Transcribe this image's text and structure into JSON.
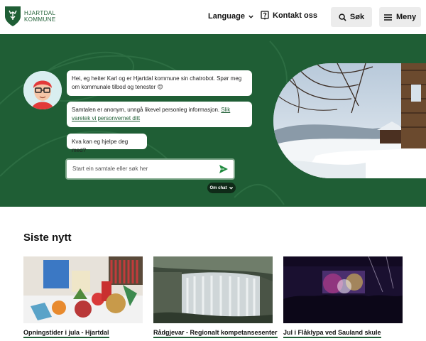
{
  "header": {
    "logo_line1": "Hjartdal",
    "logo_line2": "Kommune",
    "language_label": "Language",
    "contact_label": "Kontakt oss",
    "search_label": "Søk",
    "menu_label": "Meny",
    "icons": {
      "logo": "hjartdal-crest-icon",
      "language": "chevron-down-icon",
      "contact": "question-box-icon",
      "search": "search-icon",
      "menu": "hamburger-icon"
    }
  },
  "chatbot": {
    "messages": [
      {
        "text": "Hei, eg heiter Karl og er Hjartdal kommune sin chatrobot. Spør meg om kommunale tilbod og tenester 😊"
      },
      {
        "text": "Samtalen er anonym, unngå likevel personleg informasjon. ",
        "link": "Slik varetek vi personvernet ditt"
      },
      {
        "text": "Kva kan eg hjelpe deg med?"
      }
    ],
    "input_placeholder": "Start ein samtale eller søk her",
    "about_label": "Om chat",
    "icons": {
      "send": "send-icon",
      "avatar": "chatbot-avatar",
      "about": "chevron-down-icon"
    }
  },
  "news": {
    "heading": "Siste nytt",
    "items": [
      {
        "title": "Opningstider i jula - Hjartdal"
      },
      {
        "title": "Rådgjevar - Regionalt kompetansesenter"
      },
      {
        "title": "Jul i Flåklypa ved Sauland skule"
      }
    ]
  },
  "colors": {
    "brand_green": "#1f5e35",
    "header_button_bg": "#ececec",
    "om_chat_bg": "#0f2a18"
  }
}
